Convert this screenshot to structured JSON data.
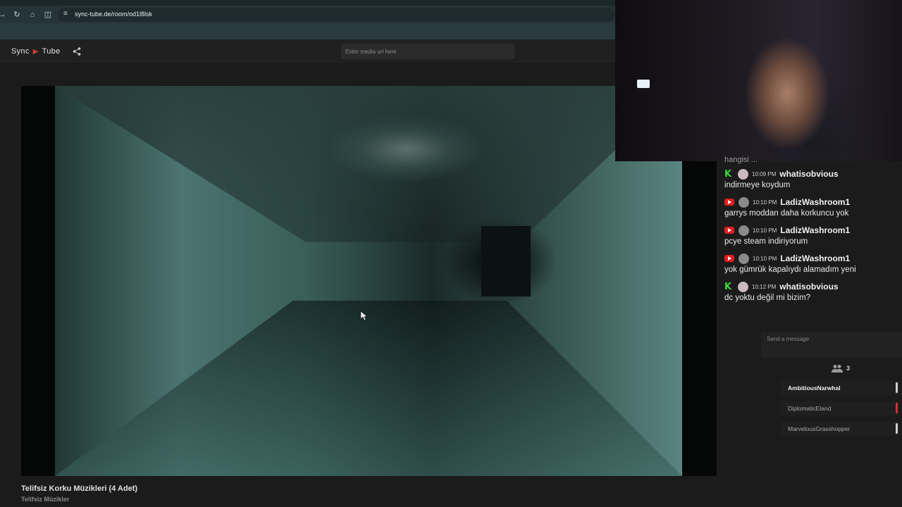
{
  "browser": {
    "url": "sync-tube.de/room/od1l8lsk",
    "icons": [
      "forward-icon",
      "reload-icon",
      "home-icon",
      "split-view-icon",
      "site-info-icon"
    ]
  },
  "app": {
    "logo_left": "Sync",
    "logo_right": "Tube",
    "media_input_placeholder": "Enter media url here"
  },
  "video": {
    "title": "Telifsiz Korku Müzikleri (4 Adet)",
    "channel": "Telifsiz Müzikler"
  },
  "chat": {
    "cut_off_text": "hangisi ...",
    "messages": [
      {
        "platform": "kick",
        "time": "10:09 PM",
        "user": "whatisobvious",
        "text": "indirmeye koydum"
      },
      {
        "platform": "youtube",
        "time": "10:10 PM",
        "user": "LadizWashroom1",
        "text": "garrys moddan daha korkuncu yok"
      },
      {
        "platform": "youtube",
        "time": "10:10 PM",
        "user": "LadizWashroom1",
        "text": "pcye steam indiriyorum"
      },
      {
        "platform": "youtube",
        "time": "10:10 PM",
        "user": "LadizWashroom1",
        "text": "yok gümrük kapalıydı alamadım yeni"
      },
      {
        "platform": "kick",
        "time": "10:12 PM",
        "user": "whatisobvious",
        "text": "dc yoktu değil mi bizim?"
      }
    ],
    "send_placeholder": "Send a message"
  },
  "users": {
    "count": "3",
    "list": [
      {
        "name": "AmbitiousNarwhal",
        "active": true,
        "bar_color": "#cfcfcf"
      },
      {
        "name": "DiplomaticEland",
        "active": false,
        "bar_color": "#d63030"
      },
      {
        "name": "MarvelousGrasshopper",
        "active": false,
        "bar_color": "#cfcfcf"
      }
    ]
  },
  "colors": {
    "accent_red": "#d23b3b",
    "kick_green": "#39d639",
    "youtube_red": "#e31e1e"
  }
}
